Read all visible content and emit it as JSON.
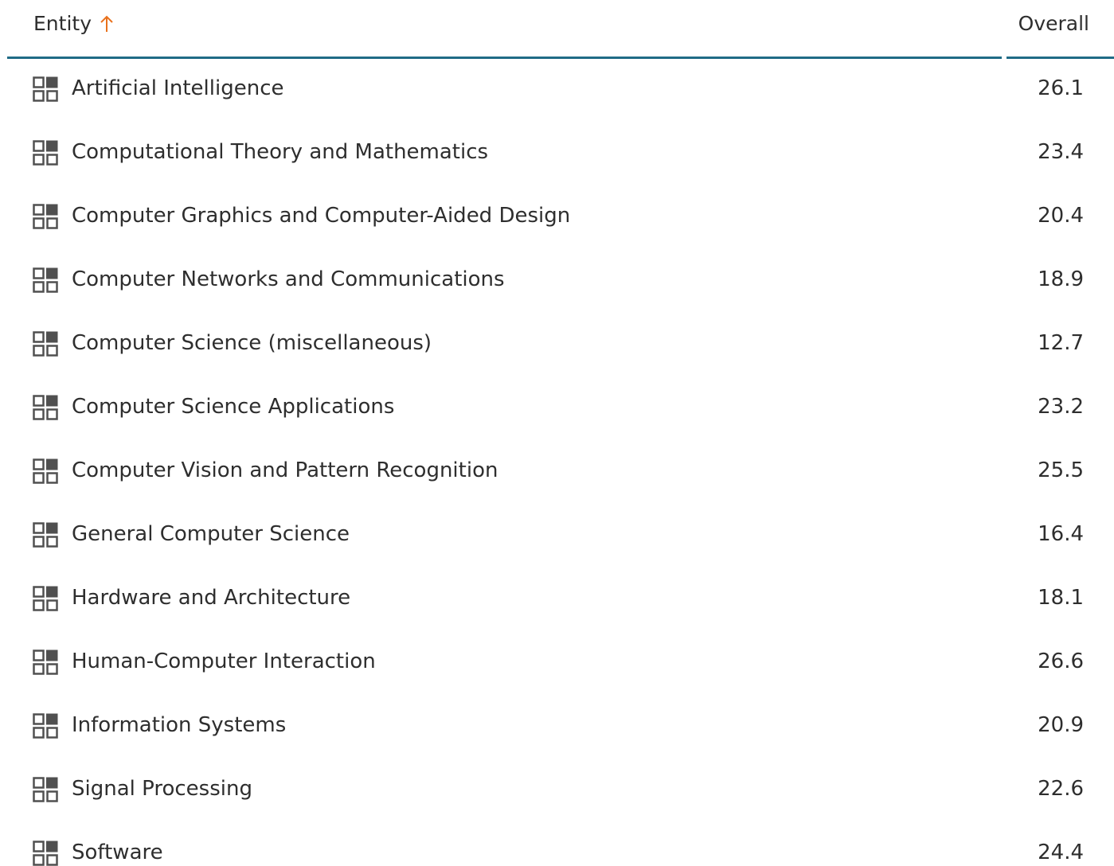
{
  "colors": {
    "header_rule": "#1f6b86",
    "sort_arrow": "#e9711c",
    "text": "#2e2e2e",
    "icon": "#505050"
  },
  "header": {
    "entity_label": "Entity",
    "sort_icon": "arrow-up-icon",
    "overall_label": "Overall"
  },
  "rows": [
    {
      "icon": "grid-icon",
      "name": "Artificial Intelligence",
      "overall": "26.1"
    },
    {
      "icon": "grid-icon",
      "name": "Computational Theory and Mathematics",
      "overall": "23.4"
    },
    {
      "icon": "grid-icon",
      "name": "Computer Graphics and Computer-Aided Design",
      "overall": "20.4"
    },
    {
      "icon": "grid-icon",
      "name": "Computer Networks and Communications",
      "overall": "18.9"
    },
    {
      "icon": "grid-icon",
      "name": "Computer Science (miscellaneous)",
      "overall": "12.7"
    },
    {
      "icon": "grid-icon",
      "name": "Computer Science Applications",
      "overall": "23.2"
    },
    {
      "icon": "grid-icon",
      "name": "Computer Vision and Pattern Recognition",
      "overall": "25.5"
    },
    {
      "icon": "grid-icon",
      "name": "General Computer Science",
      "overall": "16.4"
    },
    {
      "icon": "grid-icon",
      "name": "Hardware and Architecture",
      "overall": "18.1"
    },
    {
      "icon": "grid-icon",
      "name": "Human-Computer Interaction",
      "overall": "26.6"
    },
    {
      "icon": "grid-icon",
      "name": "Information Systems",
      "overall": "20.9"
    },
    {
      "icon": "grid-icon",
      "name": "Signal Processing",
      "overall": "22.6"
    },
    {
      "icon": "grid-icon",
      "name": "Software",
      "overall": "24.4"
    }
  ]
}
